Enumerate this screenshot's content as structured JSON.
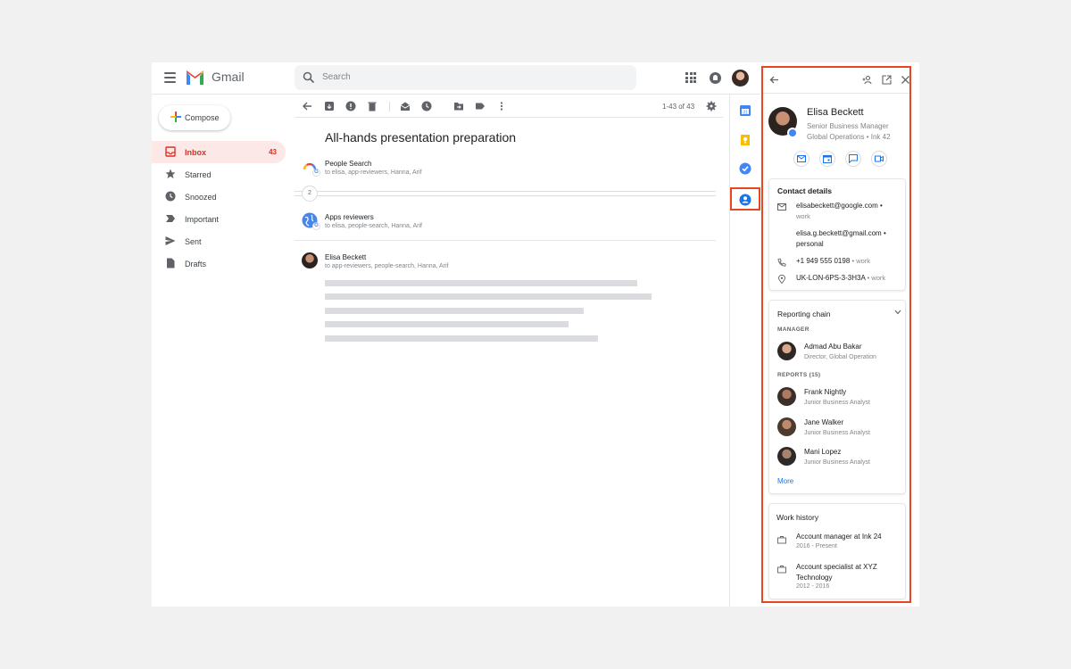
{
  "header": {
    "app_name": "Gmail",
    "search_placeholder": "Search"
  },
  "compose_label": "Compose",
  "nav": [
    {
      "label": "Inbox",
      "count": "43",
      "icon": "inbox-icon"
    },
    {
      "label": "Starred",
      "icon": "star-icon"
    },
    {
      "label": "Snoozed",
      "icon": "clock-icon"
    },
    {
      "label": "Important",
      "icon": "important-icon"
    },
    {
      "label": "Sent",
      "icon": "send-icon"
    },
    {
      "label": "Drafts",
      "icon": "draft-icon"
    }
  ],
  "toolbar": {
    "pager": "1-43 of 43"
  },
  "thread": {
    "subject": "All-hands presentation preparation",
    "collapsed_count": "2",
    "messages": [
      {
        "from": "People Search",
        "to": "to elisa, app-reviewers, Hanna, Arif"
      },
      {
        "from": "Apps reviewers",
        "to": "to elisa, people-search, Hanna, Arif"
      },
      {
        "from": "Elisa Beckett",
        "to": "to app-reviewers, people-search, Hanna, Arif"
      }
    ]
  },
  "contact": {
    "name": "Elisa Beckett",
    "title": "Senior Business Manager",
    "org": "Global Operations • Ink 42",
    "contact_details_title": "Contact details",
    "details": [
      {
        "icon": "mail-icon",
        "value": "elisabeckett@google.com •",
        "label": "work"
      },
      {
        "icon": "",
        "value": "elisa.g.beckett@gmail.com •",
        "label": "personal"
      },
      {
        "icon": "phone-icon",
        "value": "+1 949 555 0198",
        "label": "• work"
      },
      {
        "icon": "location-icon",
        "value": "UK-LON-6PS-3-3H3A",
        "label": "• work"
      }
    ],
    "reporting_title": "Reporting chain",
    "manager_label": "MANAGER",
    "manager": {
      "name": "Admad Abu Bakar",
      "title": "Director, Global Operation"
    },
    "reports_label": "REPORTS (15)",
    "reports": [
      {
        "name": "Frank Nightly",
        "title": "Junior Business Analyst"
      },
      {
        "name": "Jane Walker",
        "title": "Junior Business Analyst"
      },
      {
        "name": "Mani Lopez",
        "title": "Junior Business Analyst"
      }
    ],
    "more_label": "More",
    "work_history_title": "Work history",
    "work_history": [
      {
        "title": "Account manager at Ink 24",
        "years": "2016 - Present"
      },
      {
        "title": "Account specialist at XYZ Technology",
        "years": "2012 - 2016"
      }
    ]
  },
  "colors": {
    "accent_red": "#d93025",
    "highlight": "#e8461f",
    "link_blue": "#1a73e8"
  }
}
